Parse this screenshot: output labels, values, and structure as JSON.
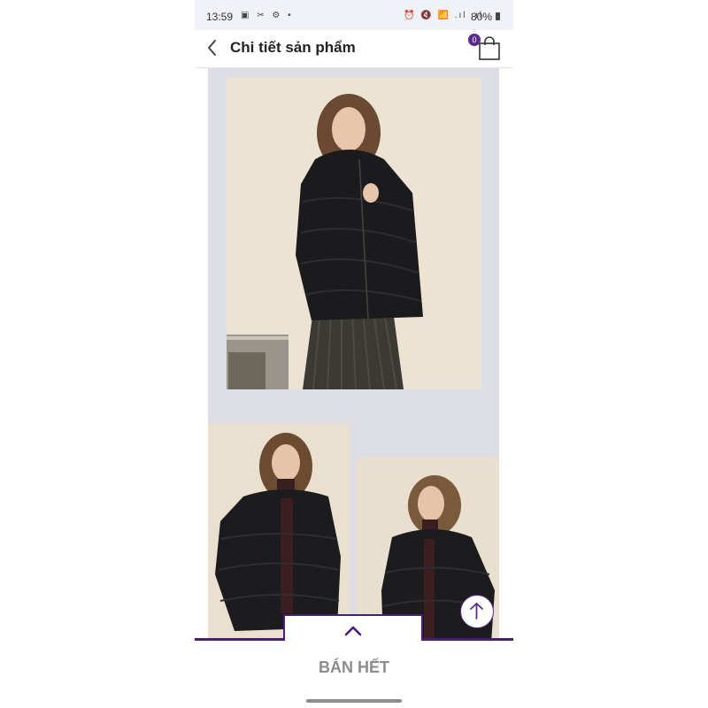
{
  "status_bar": {
    "time": "13:59",
    "left_icons": "▣ ✂ ⚙ •",
    "right_icons": "⏰ 🔇 📶 .ıl .ıl",
    "battery": "80%"
  },
  "header": {
    "title": "Chi tiết sản phẩm",
    "cart_count": "0"
  },
  "bottom": {
    "status_label": "BÁN HẾT"
  },
  "colors": {
    "accent": "#4b1d7a",
    "badge": "#5b2a8c",
    "status_bar_bg": "#f1f2f8",
    "sold_out_text": "#8c8c8c"
  },
  "icons": {
    "back": "chevron-left-icon",
    "cart": "shopping-bag-icon",
    "collapse": "chevron-up-icon",
    "scroll_top": "arrow-up-icon"
  }
}
